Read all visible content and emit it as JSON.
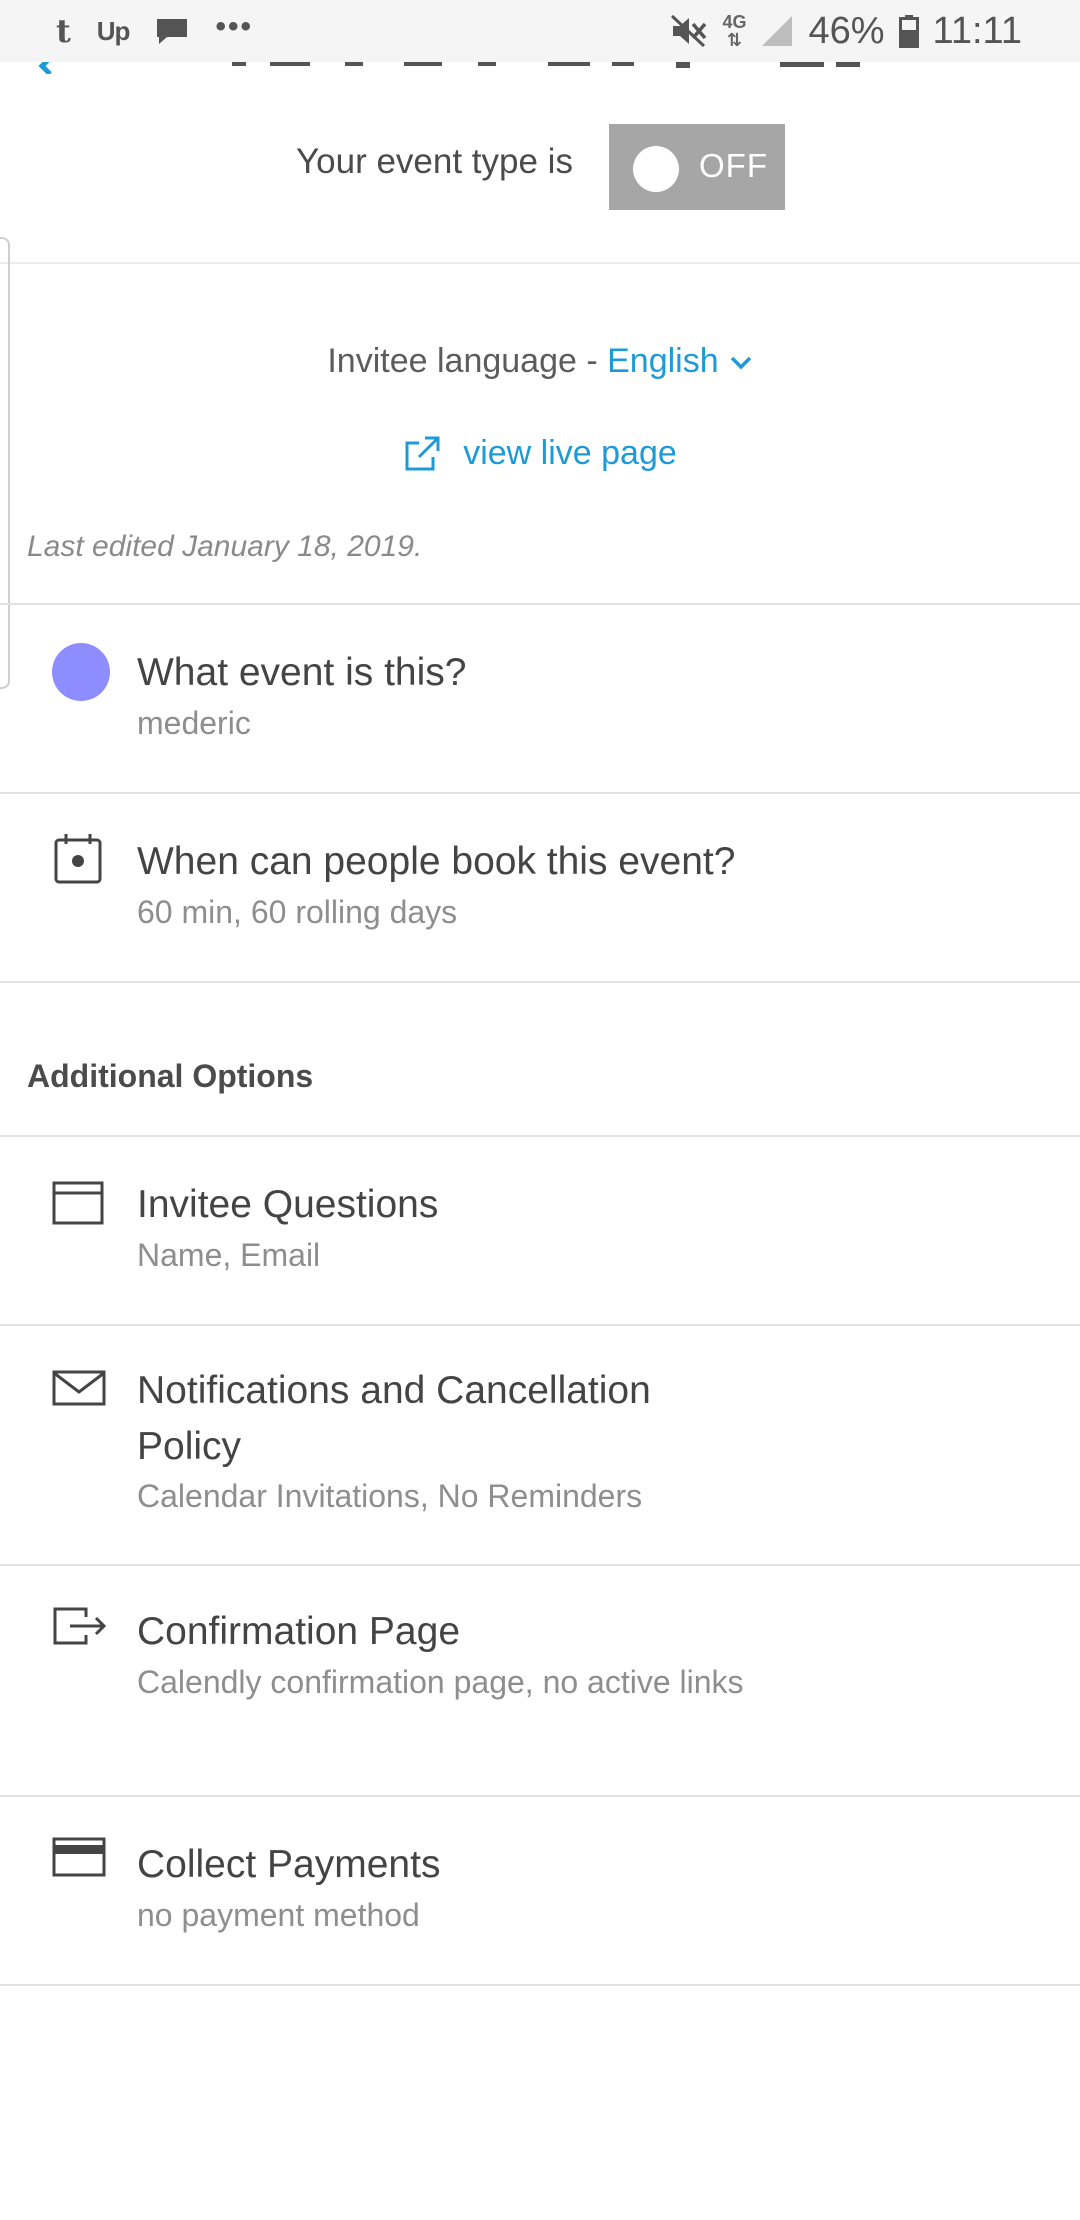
{
  "status_bar": {
    "left_icons": [
      "tumblr-icon",
      "upwork-icon",
      "message-icon",
      "more-dots-icon"
    ],
    "t_glyph": "t",
    "up_glyph": "Up",
    "dots": "•••",
    "network_label": "4G",
    "battery": "46%",
    "time": "11:11"
  },
  "toggle": {
    "label": "Your event type is",
    "state": "OFF"
  },
  "language": {
    "prefix": "Invitee language - ",
    "value": "English"
  },
  "view_live_page": "view live page",
  "last_edited": "Last edited January 18, 2019.",
  "event_rows": [
    {
      "title": "What event is this?",
      "subtitle": "mederic",
      "color": "#8d8dff"
    },
    {
      "title": "When can people book this event?",
      "subtitle": "60 min, 60 rolling days"
    }
  ],
  "additional_options": {
    "heading": "Additional Options",
    "items": [
      {
        "title": "Invitee Questions",
        "subtitle": "Name, Email",
        "icon": "form-icon"
      },
      {
        "title": "Notifications and Cancellation Policy",
        "subtitle": "Calendar Invitations, No Reminders",
        "icon": "envelope-icon"
      },
      {
        "title": "Confirmation Page",
        "subtitle": "Calendly confirmation page, no active links",
        "icon": "exit-icon"
      },
      {
        "title": "Collect Payments",
        "subtitle": "no payment method",
        "icon": "credit-card-icon"
      }
    ]
  },
  "colors": {
    "link": "#1e9bd7",
    "toggle_off": "#a6a6a6",
    "event_dot": "#8d8dff"
  }
}
